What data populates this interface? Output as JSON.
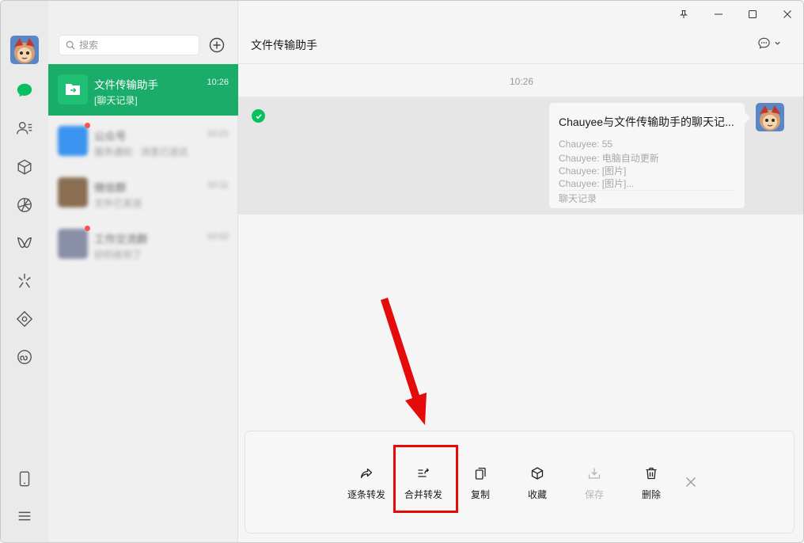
{
  "app": {
    "window_controls": [
      "pin-icon",
      "minimize-icon",
      "maximize-icon",
      "close-icon"
    ]
  },
  "rail": {
    "items": [
      {
        "name": "chat-icon",
        "active": true
      },
      {
        "name": "contacts-icon"
      },
      {
        "name": "favorites-icon"
      },
      {
        "name": "moments-icon"
      },
      {
        "name": "channels-icon"
      },
      {
        "name": "discover-icon"
      },
      {
        "name": "mini-programs-icon"
      },
      {
        "name": "mini-apps-icon"
      }
    ],
    "bottom": [
      {
        "name": "phone-icon"
      },
      {
        "name": "menu-icon"
      }
    ]
  },
  "search": {
    "placeholder": "搜索"
  },
  "conversations": [
    {
      "name": "文件传输助手",
      "time": "10:26",
      "last_msg": "[聊天记录]",
      "active": true
    },
    {
      "name": "公众号",
      "time": "10:21",
      "last_msg": "服务通知 · 消息已送达",
      "blurred": true,
      "badge": true
    },
    {
      "name": "微信群",
      "time": "10:11",
      "last_msg": "文件已发送",
      "blurred": true
    },
    {
      "name": "工作交流群",
      "time": "10:02",
      "last_msg": "好的收到了",
      "blurred": true,
      "badge": true
    }
  ],
  "chat": {
    "title": "文件传输助手",
    "time_divider": "10:26",
    "card": {
      "title": "Chauyee与文件传输助手的聊天记...",
      "lines": [
        "Chauyee: 55",
        "Chauyee: 电脑自动更新",
        "Chauyee: [图片]",
        "Chauyee: [图片]..."
      ],
      "footer": "聊天记录"
    }
  },
  "actions": [
    {
      "label": "逐条转发",
      "icon": "forward-icon"
    },
    {
      "label": "合并转发",
      "icon": "merge-forward-icon",
      "highlighted": true
    },
    {
      "label": "复制",
      "icon": "copy-icon"
    },
    {
      "label": "收藏",
      "icon": "favorite-icon"
    },
    {
      "label": "保存",
      "icon": "save-icon",
      "disabled": true
    },
    {
      "label": "删除",
      "icon": "delete-icon"
    }
  ],
  "colors": {
    "accent": "#07c160",
    "active_row": "#1aad6a",
    "highlight": "#e50b0b"
  }
}
